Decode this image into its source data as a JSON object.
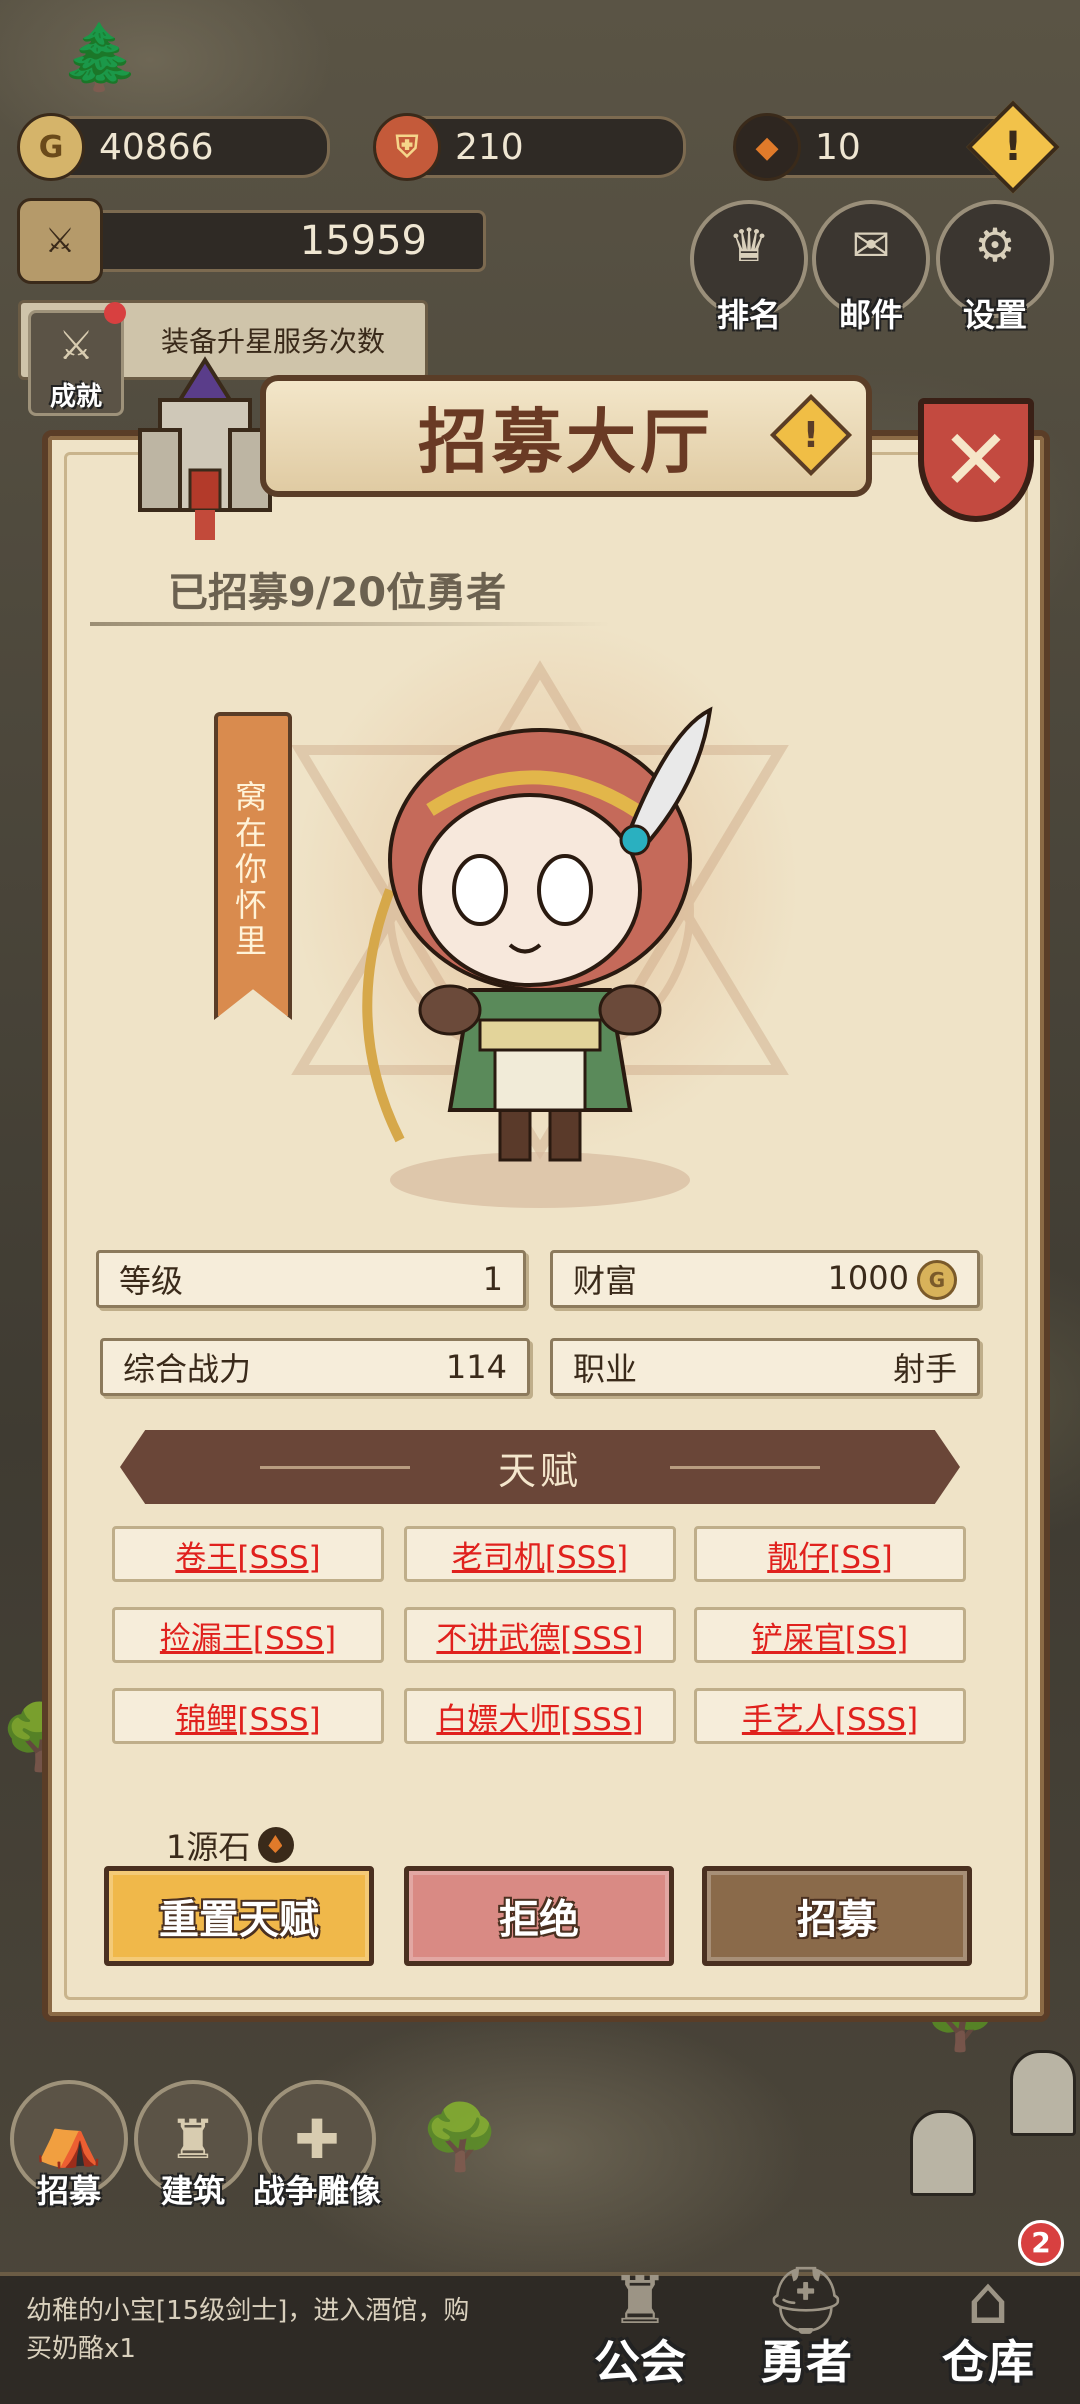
{
  "resources": {
    "gold": "40866",
    "shield": "210",
    "stone": "10",
    "power": "15959"
  },
  "top_buttons": [
    {
      "label": "排名",
      "icon": "trophy-icon"
    },
    {
      "label": "邮件",
      "icon": "mail-icon"
    },
    {
      "label": "设置",
      "icon": "gear-icon"
    }
  ],
  "achievement": {
    "label": "成就",
    "service_text": "装备升星服务次数"
  },
  "modal": {
    "title": "招募大厅",
    "recruited_text": "已招募9/20位勇者",
    "hero_tag": "窝在你怀里",
    "stats": {
      "level_label": "等级",
      "level_value": "1",
      "wealth_label": "财富",
      "wealth_value": "1000",
      "power_label": "综合战力",
      "power_value": "114",
      "class_label": "职业",
      "class_value": "射手"
    },
    "talent_header": "天赋",
    "talents": [
      "卷王[SSS]",
      "老司机[SSS]",
      "靓仔[SS]",
      "捡漏王[SSS]",
      "不讲武德[SSS]",
      "铲屎官[SS]",
      "锦鲤[SSS]",
      "白嫖大师[SSS]",
      "手艺人[SSS]"
    ],
    "cost_text": "1源石",
    "buttons": {
      "reset": "重置天赋",
      "reject": "拒绝",
      "recruit": "招募"
    }
  },
  "left_nav": [
    {
      "label": "招募",
      "icon": "tent-icon"
    },
    {
      "label": "建筑",
      "icon": "castle-icon"
    },
    {
      "label": "战争雕像",
      "icon": "statue-icon"
    }
  ],
  "ticker": {
    "text": "幼稚的小宝[15级剑士]，进入酒馆，购买奶酪x1"
  },
  "bottom_nav": [
    {
      "label": "公会",
      "icon": "guild-icon"
    },
    {
      "label": "勇者",
      "icon": "helmet-icon"
    },
    {
      "label": "仓库",
      "icon": "warehouse-icon",
      "badge": "2"
    }
  ],
  "colors": {
    "talent_text": "#e0211d",
    "reset_button": "#f0b84a",
    "reject_button": "#d98a84",
    "recruit_button": "#8a6a4a",
    "panel": "#efe3c7",
    "banner_text": "#6a3a24"
  }
}
